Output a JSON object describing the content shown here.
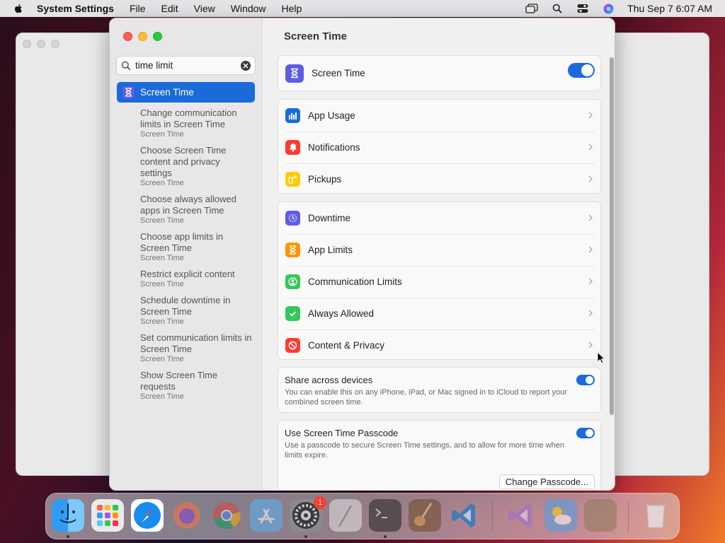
{
  "menubar": {
    "app_name": "System Settings",
    "menus": [
      "File",
      "Edit",
      "View",
      "Window",
      "Help"
    ],
    "datetime": "Thu Sep 7  6:07 AM"
  },
  "sidebar": {
    "search": {
      "value": "time limit"
    },
    "selected_item": {
      "label": "Screen Time",
      "icon": "hourglass-icon"
    },
    "results": [
      {
        "title": "Change communication limits in Screen Time",
        "subtitle": "Screen Time"
      },
      {
        "title": "Choose Screen Time content and privacy settings",
        "subtitle": "Screen Time"
      },
      {
        "title": "Choose always allowed apps in Screen Time",
        "subtitle": "Screen Time"
      },
      {
        "title": "Choose app limits in Screen Time",
        "subtitle": "Screen Time"
      },
      {
        "title": "Restrict explicit content",
        "subtitle": "Screen Time"
      },
      {
        "title": "Schedule downtime in Screen Time",
        "subtitle": "Screen Time"
      },
      {
        "title": "Set communication limits in Screen Time",
        "subtitle": "Screen Time"
      },
      {
        "title": "Show Screen Time requests",
        "subtitle": "Screen Time"
      }
    ]
  },
  "content": {
    "title": "Screen Time",
    "screen_time_row": {
      "label": "Screen Time",
      "enabled": true
    },
    "group1": [
      {
        "label": "App Usage",
        "icon": "bar-chart-icon",
        "color": "#1a6bd9"
      },
      {
        "label": "Notifications",
        "icon": "bell-icon",
        "color": "#ff3b30"
      },
      {
        "label": "Pickups",
        "icon": "pickups-icon",
        "color": "#ffcc00"
      }
    ],
    "group2": [
      {
        "label": "Downtime",
        "icon": "downtime-icon",
        "color": "#5e5ce6"
      },
      {
        "label": "App Limits",
        "icon": "hourglass-icon",
        "color": "#ff9500"
      },
      {
        "label": "Communication Limits",
        "icon": "person-icon",
        "color": "#34c759"
      },
      {
        "label": "Always Allowed",
        "icon": "checkmark-icon",
        "color": "#34c759"
      },
      {
        "label": "Content & Privacy",
        "icon": "no-entry-icon",
        "color": "#ff3b30"
      }
    ],
    "share": {
      "title": "Share across devices",
      "description": "You can enable this on any iPhone, iPad, or Mac signed in to iCloud to report your combined screen time.",
      "enabled": true
    },
    "passcode": {
      "title": "Use Screen Time Passcode",
      "description": "Use a passcode to secure Screen Time settings, and to allow for more time when limits expire.",
      "enabled": true,
      "button_label": "Change Passcode..."
    }
  },
  "dock": {
    "apps": [
      "Finder",
      "Launchpad",
      "Safari",
      "Firefox",
      "Chrome",
      "App Store",
      "System Settings",
      "TextEdit",
      "Terminal",
      "GarageBand",
      "Visual Studio Code",
      "Visual Studio",
      "Weather",
      "Notes",
      "Trash"
    ],
    "system_settings_badge": "1"
  }
}
